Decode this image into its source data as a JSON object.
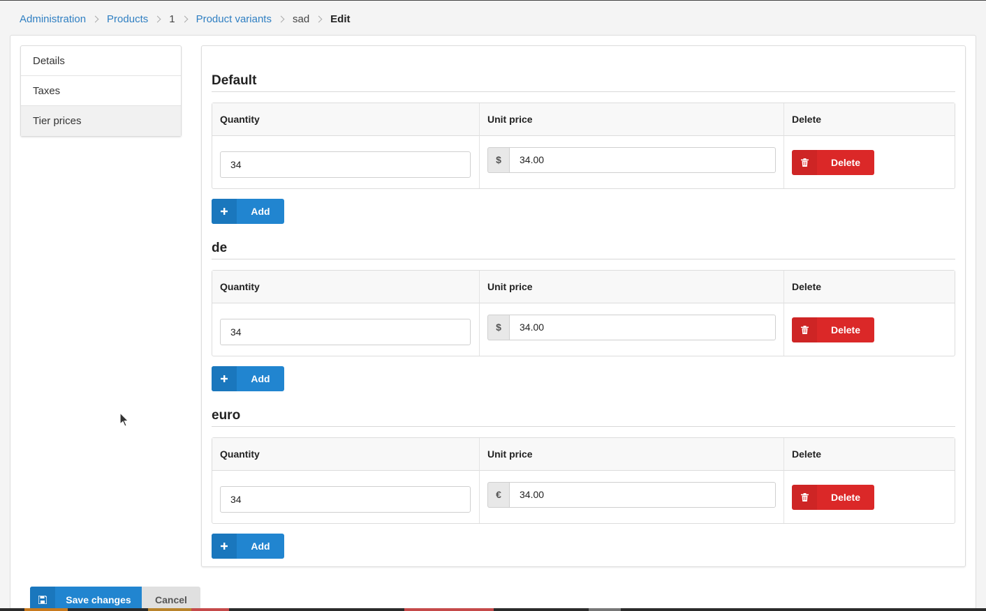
{
  "breadcrumb": {
    "administration": "Administration",
    "products": "Products",
    "product_id": "1",
    "product_variants": "Product variants",
    "variant": "sad",
    "current": "Edit"
  },
  "side_menu": {
    "items": [
      {
        "label": "Details"
      },
      {
        "label": "Taxes"
      },
      {
        "label": "Tier prices"
      }
    ]
  },
  "table_headers": {
    "quantity": "Quantity",
    "unit_price": "Unit price",
    "delete": "Delete"
  },
  "channels": [
    {
      "name": "Default",
      "quantity": "34",
      "currency": "$",
      "unit_price": "34.00"
    },
    {
      "name": "de",
      "quantity": "34",
      "currency": "$",
      "unit_price": "34.00"
    },
    {
      "name": "euro",
      "quantity": "34",
      "currency": "€",
      "unit_price": "34.00"
    }
  ],
  "buttons": {
    "delete": "Delete",
    "add": "Add",
    "save": "Save changes",
    "cancel": "Cancel"
  },
  "colors": {
    "primary": "#2185d0",
    "danger": "#db2828",
    "link": "#2f7fc2"
  }
}
